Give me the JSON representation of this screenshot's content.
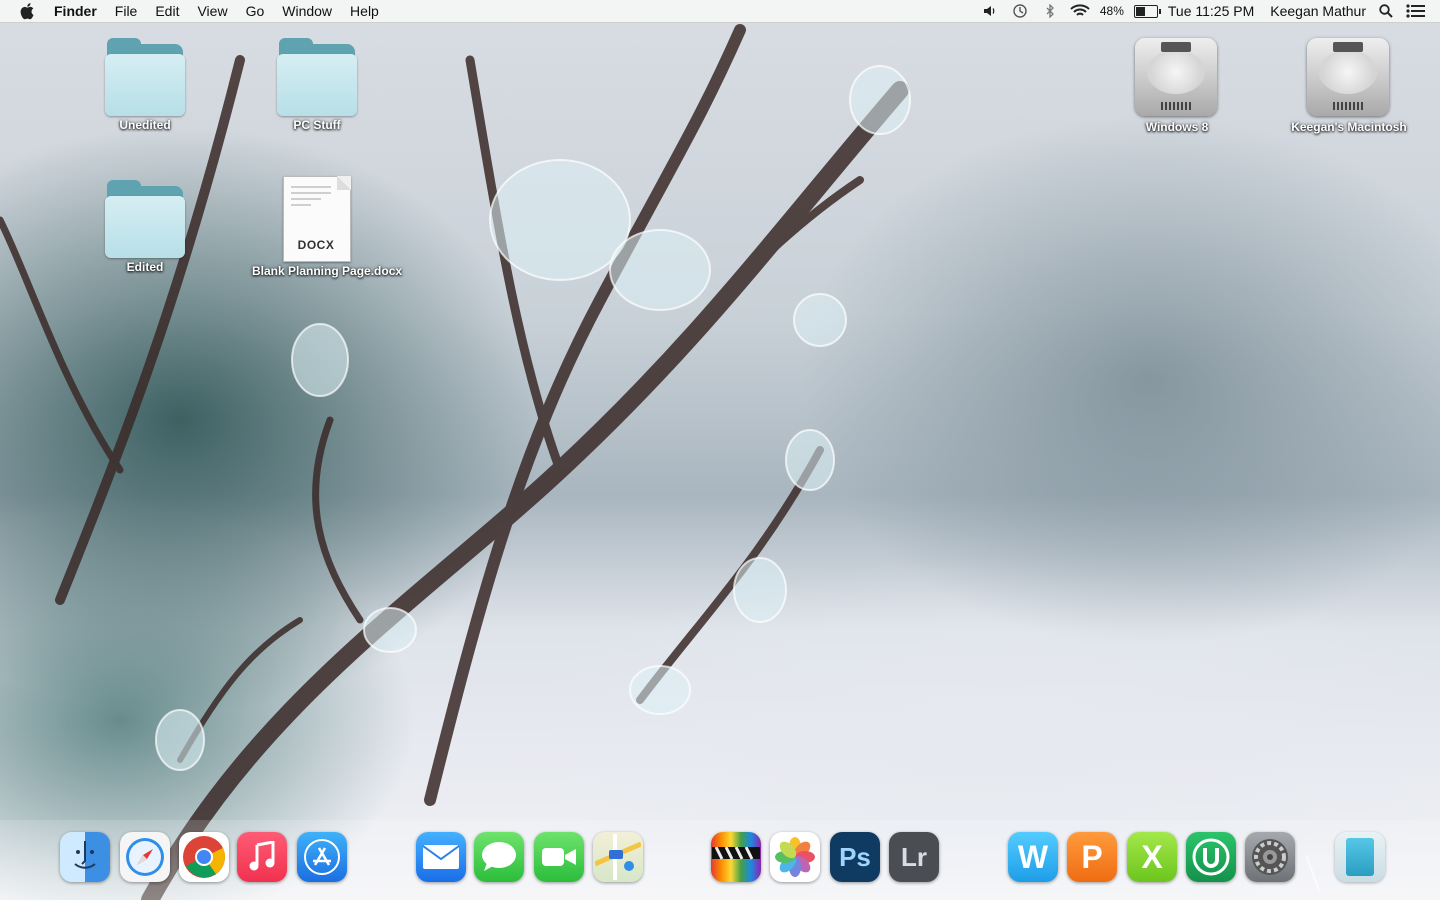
{
  "menubar": {
    "app_name": "Finder",
    "menus": [
      "File",
      "Edit",
      "View",
      "Go",
      "Window",
      "Help"
    ],
    "battery_percent": "48%",
    "battery_level": 0.48,
    "clock": "Tue 11:25 PM",
    "user": "Keegan Mathur",
    "icons": [
      "apple-icon",
      "volume-icon",
      "time-machine-icon",
      "bluetooth-icon",
      "wifi-icon",
      "battery-icon",
      "spotlight-icon",
      "notification-center-icon"
    ]
  },
  "desktop": {
    "icons": [
      {
        "label": "Unedited",
        "type": "folder"
      },
      {
        "label": "PC Stuff",
        "type": "folder"
      },
      {
        "label": "Edited",
        "type": "folder"
      },
      {
        "label": "Blank Planning Page.docx",
        "type": "document",
        "ext": "DOCX"
      },
      {
        "label": "Windows 8",
        "type": "drive"
      },
      {
        "label": "Keegan's Macintosh",
        "type": "drive"
      }
    ]
  },
  "dock": {
    "apps": [
      {
        "name": "finder-icon",
        "color": "#4aa3e8"
      },
      {
        "name": "safari-icon",
        "color": "#2f8fe8"
      },
      {
        "name": "chrome-icon",
        "color": "#ffffff"
      },
      {
        "name": "itunes-icon",
        "color": "#fa3c5a"
      },
      {
        "name": "app-store-icon",
        "color": "#1e8ff0"
      },
      {
        "name": "mail-icon",
        "color": "#1a8af0"
      },
      {
        "name": "messages-icon",
        "color": "#3ed04b"
      },
      {
        "name": "facetime-icon",
        "color": "#3ed04b"
      },
      {
        "name": "maps-icon",
        "color": "#e9e3c8"
      },
      {
        "name": "final-cut-icon",
        "color": "#222222"
      },
      {
        "name": "photos-icon",
        "color": "#ffffff"
      },
      {
        "name": "photoshop-icon",
        "color": "#0f3a62",
        "text": "Ps"
      },
      {
        "name": "lightroom-icon",
        "color": "#4a4d52",
        "text": "Lr"
      },
      {
        "name": "word-icon",
        "color": "#29b6f6",
        "text": "W"
      },
      {
        "name": "powerpoint-icon",
        "color": "#f57c1f",
        "text": "P"
      },
      {
        "name": "excel-icon",
        "color": "#7bd325",
        "text": "X"
      },
      {
        "name": "upwork-icon",
        "color": "#1fa856"
      },
      {
        "name": "system-preferences-icon",
        "color": "#8d9196"
      },
      {
        "name": "downloads-stack-icon",
        "color": "#3fb6d6"
      }
    ]
  }
}
